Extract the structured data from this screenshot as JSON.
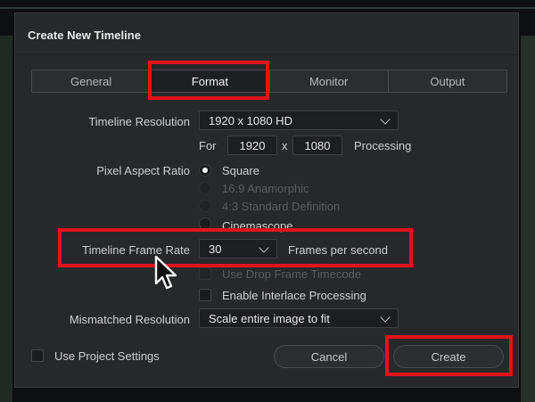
{
  "dialog": {
    "title": "Create New Timeline"
  },
  "tabs": [
    {
      "label": "General",
      "active": false
    },
    {
      "label": "Format",
      "active": true
    },
    {
      "label": "Monitor",
      "active": false
    },
    {
      "label": "Output",
      "active": false
    }
  ],
  "format": {
    "resolution_label": "Timeline Resolution",
    "resolution_value": "1920 x 1080 HD",
    "for_label": "For",
    "width": "1920",
    "x_label": "x",
    "height": "1080",
    "processing_label": "Processing",
    "pixel_aspect_label": "Pixel Aspect Ratio",
    "pixel_aspect_options": [
      {
        "label": "Square",
        "selected": true,
        "enabled": true
      },
      {
        "label": "16:9 Anamorphic",
        "selected": false,
        "enabled": false
      },
      {
        "label": "4:3 Standard Definition",
        "selected": false,
        "enabled": false
      },
      {
        "label": "Cinemascope",
        "selected": false,
        "enabled": true
      }
    ],
    "frame_rate_label": "Timeline Frame Rate",
    "frame_rate_value": "30",
    "frame_rate_unit": "Frames per second",
    "drop_frame_label": "Use Drop Frame Timecode",
    "interlace_label": "Enable Interlace Processing",
    "mismatched_label": "Mismatched Resolution",
    "mismatched_value": "Scale entire image to fit"
  },
  "footer": {
    "use_project_settings_label": "Use Project Settings",
    "cancel_label": "Cancel",
    "create_label": "Create"
  },
  "colors": {
    "highlight": "#e0141b",
    "dialog_bg": "#27282a"
  }
}
